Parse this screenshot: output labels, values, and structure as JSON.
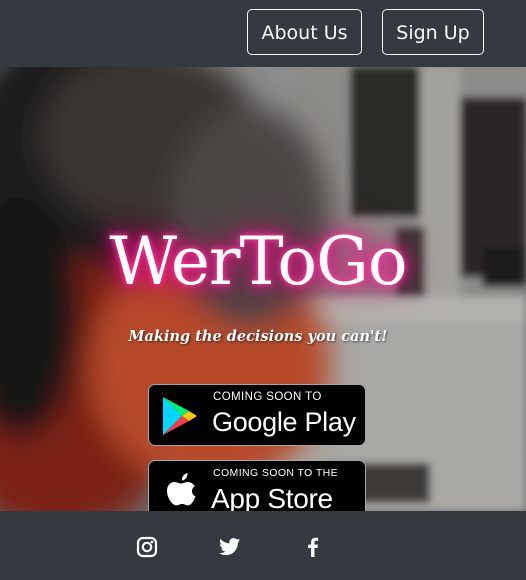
{
  "navbar": {
    "about_label": "About Us",
    "signup_label": "Sign Up"
  },
  "hero": {
    "brand": "WerToGo",
    "tagline": "Making the decisions you can't!",
    "glow_color": "#ff1e96",
    "google_badge": {
      "small": "COMING SOON TO",
      "big": "Google Play",
      "icon": "google-play-icon"
    },
    "apple_badge": {
      "small": "COMING SOON TO THE",
      "big": "App Store",
      "icon": "apple-icon"
    }
  },
  "footer": {
    "social": [
      {
        "name": "instagram",
        "icon": "instagram-icon"
      },
      {
        "name": "twitter",
        "icon": "twitter-icon"
      },
      {
        "name": "facebook",
        "icon": "facebook-icon"
      }
    ]
  },
  "colors": {
    "bar": "#343a40",
    "text_light": "#f8f9fa"
  }
}
